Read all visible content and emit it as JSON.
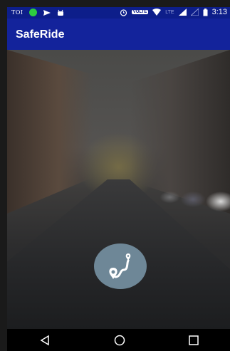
{
  "status_bar": {
    "carrier_badge": "TOI",
    "volte_label": "VOLTE",
    "lte_label": "LTE",
    "time": "3:13"
  },
  "app_bar": {
    "title": "SafeRide"
  },
  "icons": {
    "nav_back": "back-icon",
    "nav_home": "home-icon",
    "nav_recents": "recents-icon",
    "fab": "route-icon"
  },
  "colors": {
    "status_bar": "#0d1e8a",
    "app_bar": "#13239b",
    "fab": "#6e8797",
    "nav_bar": "#000000"
  }
}
